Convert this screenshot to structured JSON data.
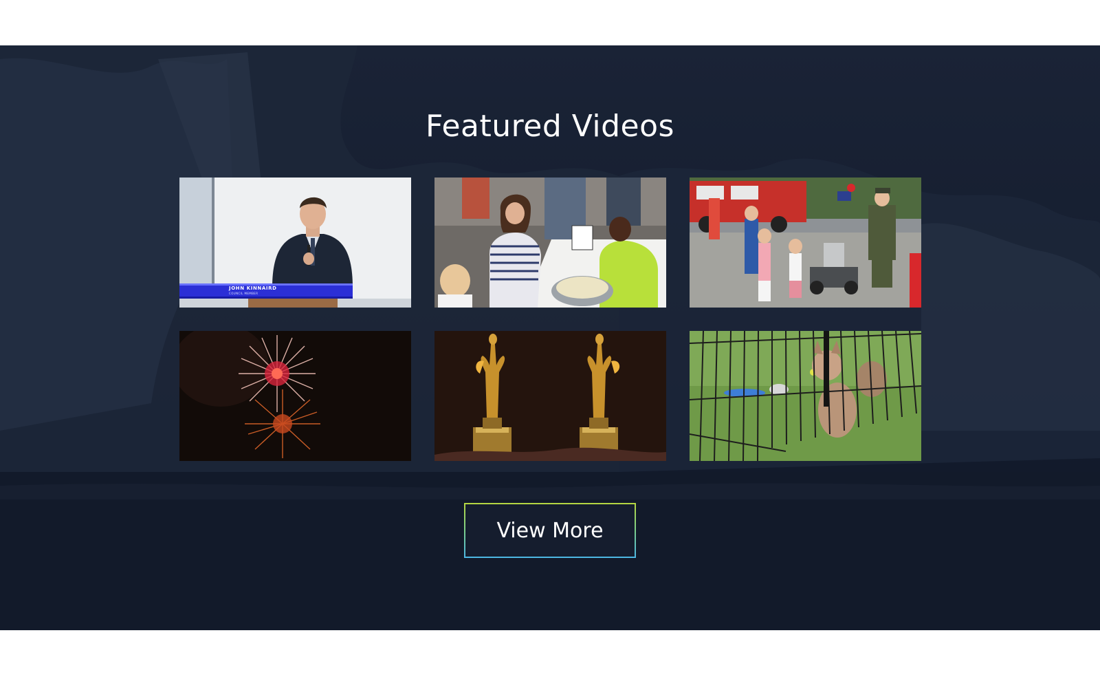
{
  "section": {
    "title": "Featured Videos",
    "view_more_label": "View More"
  },
  "videos": [
    {
      "scene": "speaker at podium",
      "caption_name": "John Kinnaird",
      "caption_title": "Council Member"
    },
    {
      "scene": "children cooking activity"
    },
    {
      "scene": "parade with fire truck and robot"
    },
    {
      "scene": "fireworks at night"
    },
    {
      "scene": "two golden award statuettes"
    },
    {
      "scene": "puppies in a playpen on grass"
    }
  ],
  "colors": {
    "section_background": "#172033",
    "title_text": "#ffffff",
    "button_border_top": "#b6d640",
    "button_border_bottom": "#4cb7e6"
  }
}
